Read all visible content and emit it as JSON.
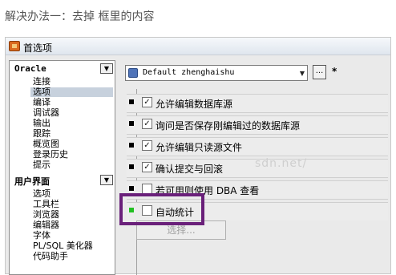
{
  "caption": "解决办法一：去掉 框里的内容",
  "window": {
    "title": "首选项"
  },
  "sidebar": {
    "oracle_header": "Oracle",
    "oracle_items": [
      "连接",
      "选项",
      "编译",
      "调试器",
      "输出",
      "跟踪",
      "概览图",
      "登录历史",
      "提示"
    ],
    "selected_item": "选项",
    "ui_header": "用户界面",
    "ui_items": [
      "选项",
      "工具栏",
      "浏览器",
      "编辑器",
      "字体",
      "PL/SQL 美化器",
      "代码助手"
    ]
  },
  "toolbar": {
    "profile_value": "Default zhenghaishu",
    "ellipsis_label": "...",
    "modified_marker": "*"
  },
  "options": [
    {
      "label": "允许编辑数据库源",
      "checked": true
    },
    {
      "label": "询问是否保存刚编辑过的数据库源",
      "checked": true
    },
    {
      "label": "允许编辑只读源文件",
      "checked": true
    },
    {
      "label": "确认提交与回滚",
      "checked": true
    },
    {
      "label": "若可用则使用 DBA 查看",
      "checked": false
    },
    {
      "label": "自动统计",
      "checked": false
    }
  ],
  "select_button_label": "选择...",
  "watermark": "sdn.net/",
  "colors": {
    "highlight_box": "#6a207a",
    "selected_tree_item": "#c7d1dd",
    "green_marker": "#22c022"
  }
}
